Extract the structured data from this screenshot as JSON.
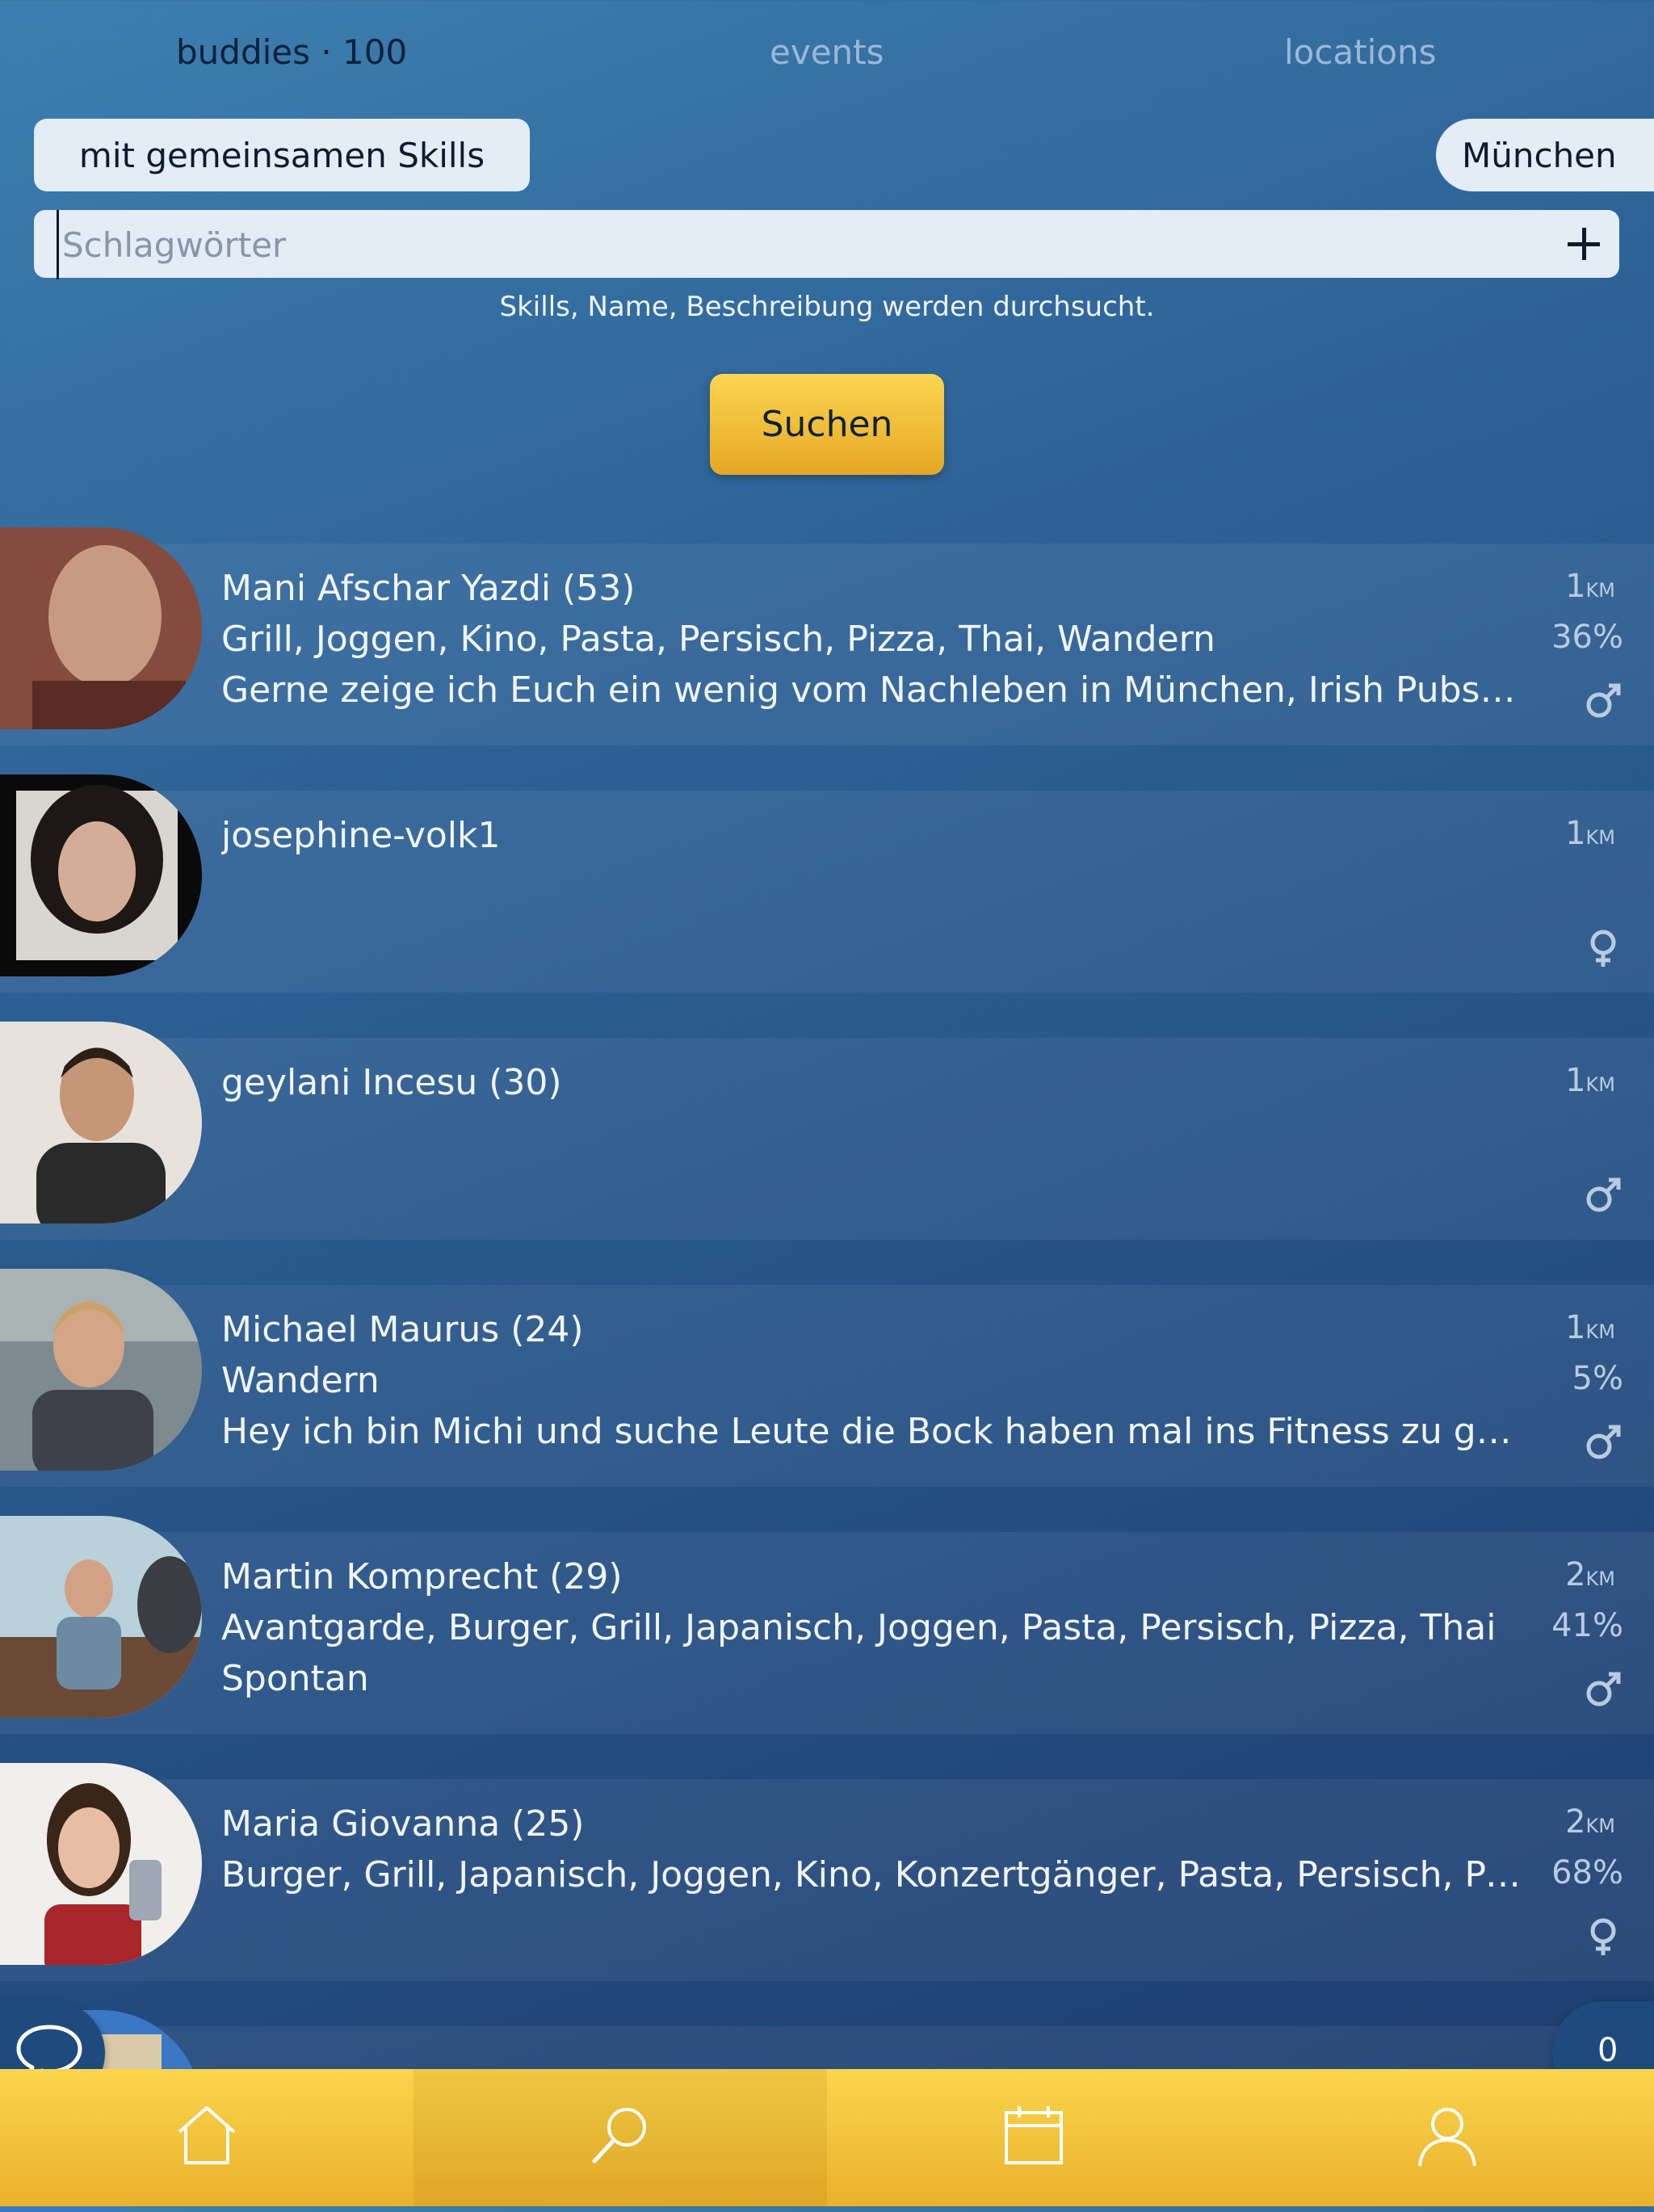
{
  "tabs": [
    {
      "label": "buddies · 100",
      "active": true
    },
    {
      "label": "events",
      "active": false
    },
    {
      "label": "locations",
      "active": false
    }
  ],
  "filters": {
    "skills_label": "mit gemeinsamen Skills",
    "city_label": "München"
  },
  "search": {
    "placeholder": "Schlagwörter",
    "hint": "Skills, Name, Beschreibung werden durchsucht.",
    "button_label": "Suchen"
  },
  "results": [
    {
      "name": "Mani Afschar Yazdi (53)",
      "skills": "Grill, Joggen, Kino, Pasta, Persisch, Pizza, Thai, Wandern",
      "description": "Gerne zeige ich Euch ein wenig vom Nachleben in München, Irish Pubs, ...",
      "distance": "1",
      "unit": "KM",
      "match": "36%",
      "gender": "male"
    },
    {
      "name": "josephine-volk1",
      "skills": "",
      "description": "",
      "distance": "1",
      "unit": "KM",
      "match": "",
      "gender": "female"
    },
    {
      "name": "geylani Incesu (30)",
      "skills": "",
      "description": "",
      "distance": "1",
      "unit": "KM",
      "match": "",
      "gender": "male"
    },
    {
      "name": "Michael Maurus (24)",
      "skills": "Wandern",
      "description": "Hey ich bin Michi und suche Leute die Bock haben mal ins Fitness zu ge...",
      "distance": "1",
      "unit": "KM",
      "match": "5%",
      "gender": "male"
    },
    {
      "name": "Martin Komprecht (29)",
      "skills": "Avantgarde, Burger, Grill, Japanisch, Joggen, Pasta, Persisch, Pizza, Thai",
      "description": "Spontan",
      "distance": "2",
      "unit": "KM",
      "match": "41%",
      "gender": "male"
    },
    {
      "name": "Maria Giovanna (25)",
      "skills": "Burger, Grill, Japanisch, Joggen, Kino, Konzertgänger, Pasta, Persisch, Piz...",
      "description": "",
      "distance": "2",
      "unit": "KM",
      "match": "68%",
      "gender": "female"
    }
  ],
  "unread_count": "0",
  "nav": [
    {
      "icon": "home-icon",
      "active": false
    },
    {
      "icon": "search-icon",
      "active": true
    },
    {
      "icon": "calendar-icon",
      "active": false
    },
    {
      "icon": "profile-icon",
      "active": false
    }
  ]
}
